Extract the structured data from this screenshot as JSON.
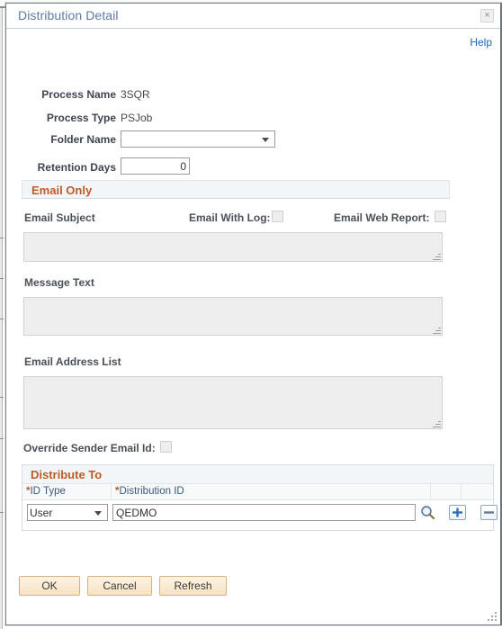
{
  "window": {
    "title": "Distribution Detail",
    "close_icon": "close-icon",
    "close_glyph": "×",
    "help_label": "Help"
  },
  "background": {
    "ghost_text": "········· ········· · ·· ··· ·· ···· ···"
  },
  "form": {
    "process_name_label": "Process Name",
    "process_name_value": "3SQR",
    "process_type_label": "Process Type",
    "process_type_value": "PSJob",
    "folder_name_label": "Folder Name",
    "folder_name_value": "",
    "folder_name_options": [
      ""
    ],
    "retention_days_label": "Retention Days",
    "retention_days_value": "0"
  },
  "email_section": {
    "title": "Email Only",
    "email_subject_label": "Email Subject",
    "email_subject_value": "",
    "email_with_log_label": "Email With Log:",
    "email_with_log_checked": false,
    "email_web_report_label": "Email Web Report:",
    "email_web_report_checked": false,
    "message_text_label": "Message Text",
    "message_text_value": "",
    "email_address_list_label": "Email Address List",
    "email_address_list_value": "",
    "override_sender_label": "Override Sender Email Id:",
    "override_sender_checked": false
  },
  "distribute_to": {
    "title": "Distribute To",
    "columns": [
      {
        "required": true,
        "label": "ID Type"
      },
      {
        "required": true,
        "label": "Distribution ID"
      },
      {
        "required": false,
        "label": ""
      },
      {
        "required": false,
        "label": ""
      }
    ],
    "rows": [
      {
        "id_type": "User",
        "id_type_options": [
          "User"
        ],
        "distribution_id": "QEDMO",
        "lookup_icon": "magnifying-glass-icon",
        "add_icon": "plus-icon",
        "remove_icon": "minus-icon"
      }
    ]
  },
  "actions": {
    "ok_label": "OK",
    "cancel_label": "Cancel",
    "refresh_label": "Refresh"
  },
  "colors": {
    "title_blue": "#5b7ba5",
    "section_orange": "#c05a21",
    "link_blue": "#1d66b3",
    "header_blue": "#3c5a78",
    "button_tan": "#f7e3c3",
    "plus_blue": "#2f6fb5"
  }
}
